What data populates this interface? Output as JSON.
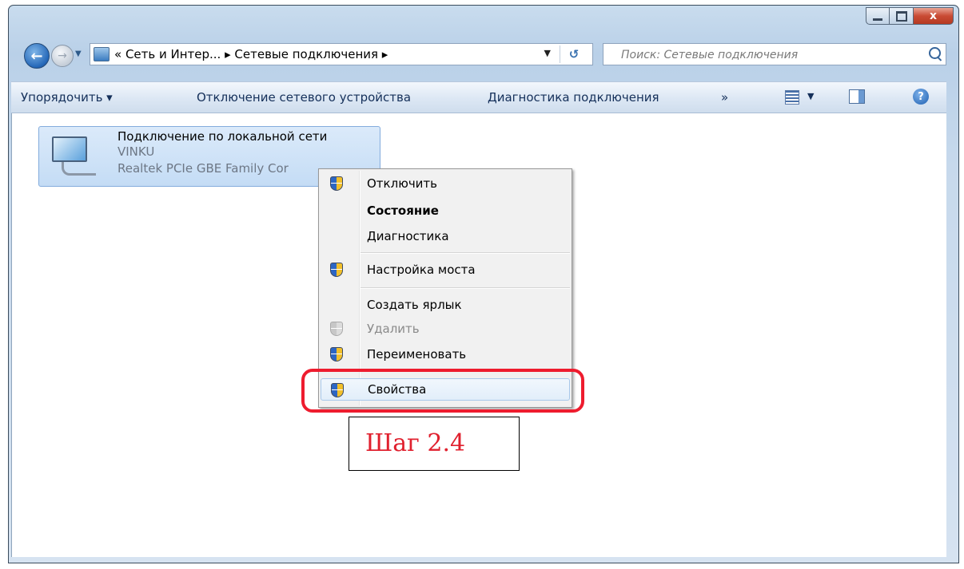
{
  "window": {
    "controls": {
      "minimize": "",
      "maximize": "",
      "close": "x"
    }
  },
  "nav": {
    "back_glyph": "←",
    "forward_glyph": "→",
    "address_path": "« Сеть и Интер... ▸ Сетевые подключения ▸",
    "refresh_glyph": "↺",
    "search_placeholder": "Поиск: Сетевые подключения"
  },
  "toolbar": {
    "organize": "Упорядочить ▾",
    "disable_device": "Отключение сетевого устройства",
    "diagnose": "Диагностика подключения",
    "more": "»",
    "help": "?"
  },
  "connection": {
    "name": "Подключение по локальной сети",
    "network": "VINKU",
    "device": "Realtek PCIe GBE Family Cor"
  },
  "context_menu": {
    "items": [
      {
        "label": "Отключить",
        "icon": "shield-icon"
      },
      {
        "label": "Состояние",
        "icon": ""
      },
      {
        "label": "Диагностика",
        "icon": ""
      },
      {
        "label": "Настройка моста",
        "icon": "shield-icon"
      },
      {
        "label": "Создать ярлык",
        "icon": ""
      },
      {
        "label": "Удалить",
        "icon": "shield-icon-disabled"
      },
      {
        "label": "Переименовать",
        "icon": "shield-icon"
      },
      {
        "label": "Свойства",
        "icon": "shield-icon"
      }
    ]
  },
  "annotation": {
    "step": "Шаг 2.4",
    "highlight_color": "#ee1c2e"
  }
}
